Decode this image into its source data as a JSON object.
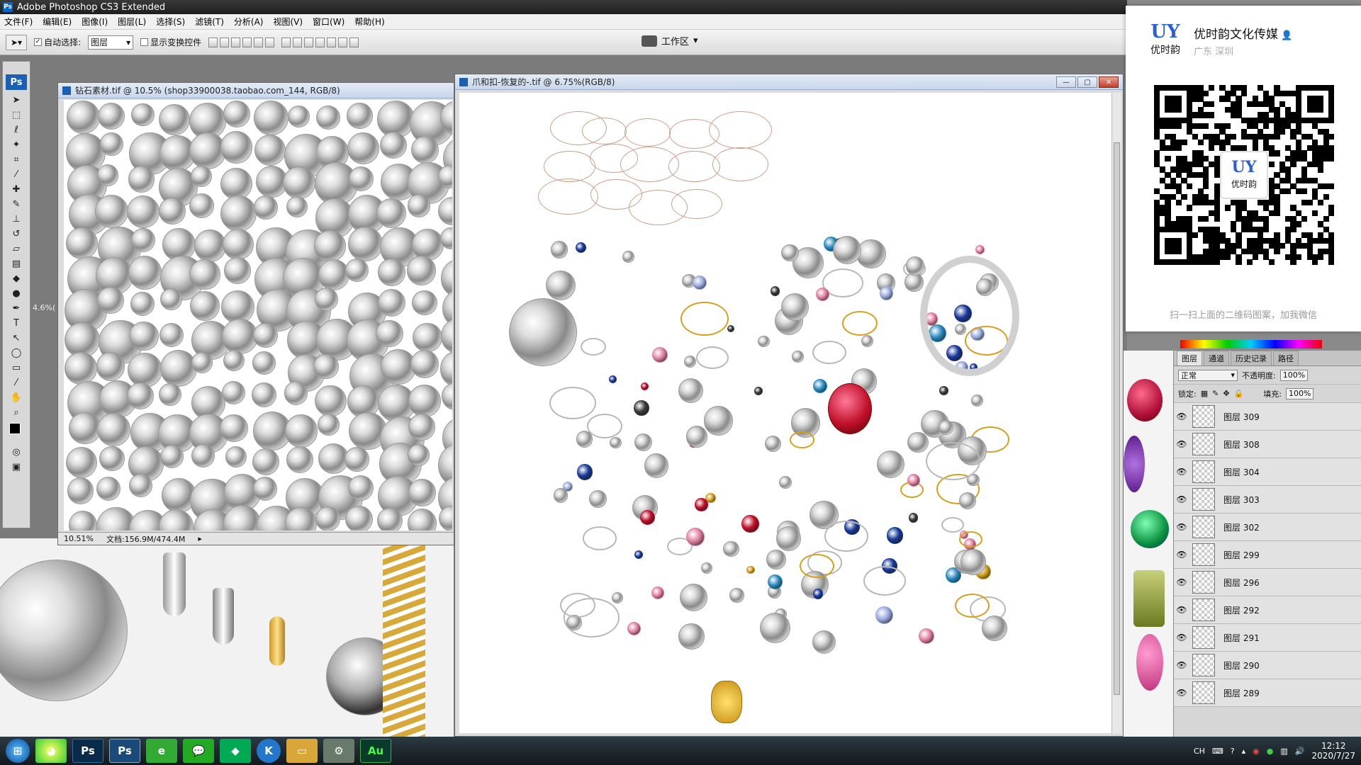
{
  "app": {
    "title": "Adobe Photoshop CS3 Extended",
    "logo": "Ps"
  },
  "menu": [
    "文件(F)",
    "编辑(E)",
    "图像(I)",
    "图层(L)",
    "选择(S)",
    "滤镜(T)",
    "分析(A)",
    "视图(V)",
    "窗口(W)",
    "帮助(H)"
  ],
  "options": {
    "auto_select_label": "自动选择:",
    "auto_select_value": "图层",
    "show_transform_label": "显示变换控件",
    "workspace_label": "工作区"
  },
  "doc1": {
    "title": "钻石素材.tif @ 10.5% (shop33900038.taobao.com_144, RGB/8)",
    "zoom": "10.51%",
    "docsize": "文档:156.9M/474.4M",
    "side_zoom": "4.6%("
  },
  "doc2": {
    "title": "爪和扣-恢复的-.tif @ 6.75%(RGB/8)"
  },
  "layers_panel": {
    "tabs": [
      "图层",
      "通道",
      "历史记录",
      "路径"
    ],
    "blend_mode": "正常",
    "opacity_label": "不透明度:",
    "opacity_value": "100%",
    "lock_label": "锁定:",
    "fill_label": "填充:",
    "fill_value": "100%",
    "layers": [
      "图层 309",
      "图层 308",
      "图层 304",
      "图层 303",
      "图层 302",
      "图层 299",
      "图层 296",
      "图层 292",
      "图层 291",
      "图层 290",
      "图层 289"
    ]
  },
  "wechat": {
    "name": "优时韵文化传媒",
    "location": "广东 深圳",
    "logo_text": "优时韵",
    "logo_mark": "UY",
    "hint": "扫一扫上面的二维码图案，加我微信"
  },
  "taskbar": {
    "apps": [
      "start",
      "browser",
      "Ps",
      "Ps",
      "360",
      "wechat",
      "app",
      "K",
      "explorer",
      "tool",
      "Au"
    ],
    "ime": "CH",
    "time": "12:12",
    "date": "2020/7/27"
  }
}
